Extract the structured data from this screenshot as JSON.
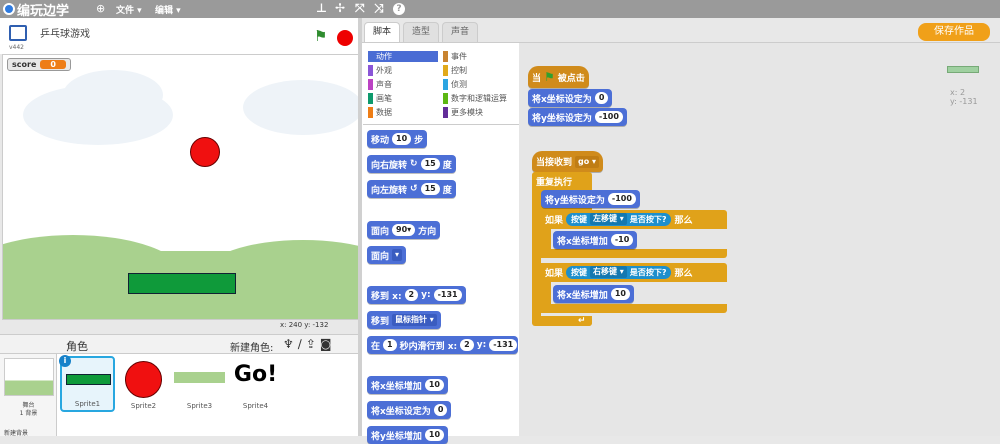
{
  "app": {
    "logo_text": "编玩边学",
    "menu_file": "文件 ▾",
    "menu_edit": "编辑 ▾"
  },
  "toolbar": {
    "icons": [
      "stamp-icon",
      "cut-icon",
      "grow-icon",
      "shrink-icon",
      "help-icon"
    ],
    "help": "?"
  },
  "project": {
    "title": "乒乓球游戏",
    "version": "v442"
  },
  "stage": {
    "score_label": "score",
    "score_value": "0",
    "coords": "x: 240  y: -132"
  },
  "sprites_panel": {
    "header": "角色",
    "new_sprite": "新建角色:",
    "stage_label": "舞台",
    "backdrop_count": "1 背景",
    "new_backdrop": "新建背景",
    "sprites": [
      {
        "name": "Sprite1",
        "selected": true
      },
      {
        "name": "Sprite2"
      },
      {
        "name": "Sprite3"
      },
      {
        "name": "Sprite4",
        "text": "Go!"
      }
    ]
  },
  "tabs": [
    "脚本",
    "造型",
    "声音"
  ],
  "categories": [
    {
      "label": "动作",
      "color": "#4a6cd4",
      "active": true
    },
    {
      "label": "事件",
      "color": "#c88330"
    },
    {
      "label": "外观",
      "color": "#8a55d7"
    },
    {
      "label": "控制",
      "color": "#e1a91a"
    },
    {
      "label": "声音",
      "color": "#bb42c3"
    },
    {
      "label": "侦测",
      "color": "#2ca5e2"
    },
    {
      "label": "画笔",
      "color": "#0e9a6c"
    },
    {
      "label": "数字和逻辑运算",
      "color": "#5cb712"
    },
    {
      "label": "数据",
      "color": "#ee7d16"
    },
    {
      "label": "更多模块",
      "color": "#632d99"
    }
  ],
  "palette_blocks": {
    "move": {
      "a": "移动",
      "n": "10",
      "b": "步"
    },
    "turn_right": {
      "a": "向右旋转",
      "n": "15",
      "b": "度"
    },
    "turn_left": {
      "a": "向左旋转",
      "n": "15",
      "b": "度"
    },
    "point_dir": {
      "a": "面向",
      "n": "90▾",
      "b": "方向"
    },
    "point_to": {
      "a": "面向",
      "dd": "▾"
    },
    "goto_xy": {
      "a": "移到 x:",
      "x": "2",
      "ylab": "y:",
      "y": "-131"
    },
    "goto": {
      "a": "移到",
      "dd": "鼠标指针 ▾"
    },
    "glide": {
      "a": "在",
      "n": "1",
      "b": "秒内滑行到 x:",
      "x": "2",
      "ylab": "y:",
      "y": "-131"
    },
    "change_x": {
      "a": "将x坐标增加",
      "n": "10"
    },
    "set_x": {
      "a": "将x坐标设定为",
      "n": "0"
    },
    "change_y": {
      "a": "将y坐标增加",
      "n": "10"
    }
  },
  "script": {
    "hat": {
      "a": "当",
      "b": "被点击"
    },
    "set_x": {
      "a": "将x坐标设定为",
      "n": "0"
    },
    "set_y": {
      "a": "将y坐标设定为",
      "n": "-100"
    },
    "recv": {
      "a": "当接收到",
      "dd": "go ▾"
    },
    "forever": "重复执行",
    "set_y2": {
      "a": "将y坐标设定为",
      "n": "-100"
    },
    "if1": {
      "a": "如果",
      "k": "按键",
      "key": "左移键 ▾",
      "q": "是否按下?",
      "b": "那么"
    },
    "chg1": {
      "a": "将x坐标增加",
      "n": "-10"
    },
    "if2": {
      "a": "如果",
      "k": "按键",
      "key": "右移键 ▾",
      "q": "是否按下?",
      "b": "那么"
    },
    "chg2": {
      "a": "将x坐标增加",
      "n": "10"
    }
  },
  "save_label": "保存作品",
  "sprite_xy": {
    "x": "x: 2",
    "y": "y: -131"
  }
}
